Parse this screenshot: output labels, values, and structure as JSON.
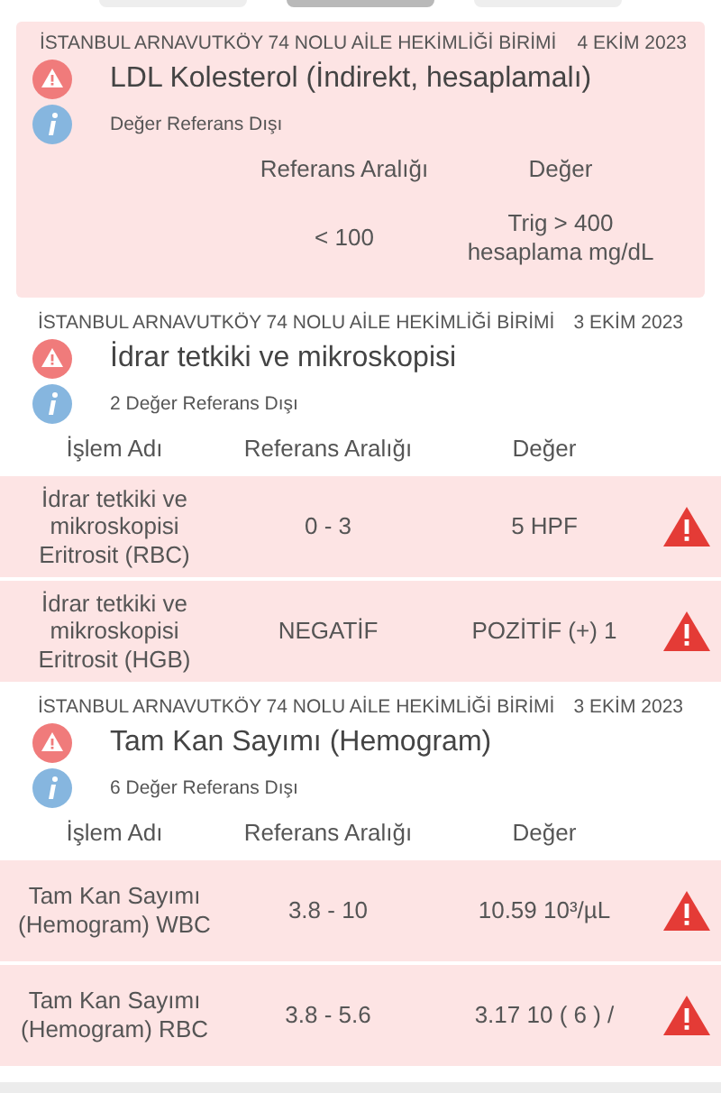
{
  "tabs": [
    {
      "selected": false
    },
    {
      "selected": true
    },
    {
      "selected": false
    }
  ],
  "cards": [
    {
      "highlighted": true,
      "facility": "İSTANBUL ARNAVUTKÖY 74 NOLU AİLE HEKİMLİĞİ BİRİMİ",
      "date": "4 EKİM 2023",
      "title": "LDL Kolesterol (İndirekt, hesaplamalı)",
      "note": "Değer Referans Dışı",
      "columns": {
        "range": "Referans Aralığı",
        "value": "Değer"
      },
      "rows": [
        {
          "range": "< 100",
          "value": "Trig > 400 hesaplama mg/dL",
          "flagged": false
        }
      ]
    },
    {
      "highlighted": false,
      "facility": "İSTANBUL ARNAVUTKÖY 74 NOLU AİLE HEKİMLİĞİ BİRİMİ",
      "date": "3 EKİM 2023",
      "title": "İdrar tetkiki ve mikroskopisi",
      "note": "2 Değer Referans Dışı",
      "columns": {
        "name": "İşlem Adı",
        "range": "Referans Aralığı",
        "value": "Değer"
      },
      "rows": [
        {
          "name": "İdrar tetkiki ve mikroskopisi Eritrosit (RBC)",
          "range": "0 - 3",
          "value": "5 HPF",
          "flagged": true
        },
        {
          "name": "İdrar tetkiki ve mikroskopisi Eritrosit (HGB)",
          "range": "NEGATİF",
          "value": "POZİTİF (+) 1",
          "flagged": true
        }
      ]
    },
    {
      "highlighted": false,
      "facility": "İSTANBUL ARNAVUTKÖY 74 NOLU AİLE HEKİMLİĞİ BİRİMİ",
      "date": "3 EKİM 2023",
      "title": "Tam Kan Sayımı (Hemogram)",
      "note": "6 Değer Referans Dışı",
      "columns": {
        "name": "İşlem Adı",
        "range": "Referans Aralığı",
        "value": "Değer"
      },
      "rows": [
        {
          "name": "Tam Kan Sayımı (Hemogram) WBC",
          "range": "3.8 - 10",
          "value": "10.59 10³/µL",
          "flagged": true
        },
        {
          "name": "Tam Kan Sayımı (Hemogram) RBC",
          "range": "3.8 - 5.6",
          "value": "3.17 10 ( 6 ) /",
          "flagged": true
        }
      ]
    }
  ]
}
